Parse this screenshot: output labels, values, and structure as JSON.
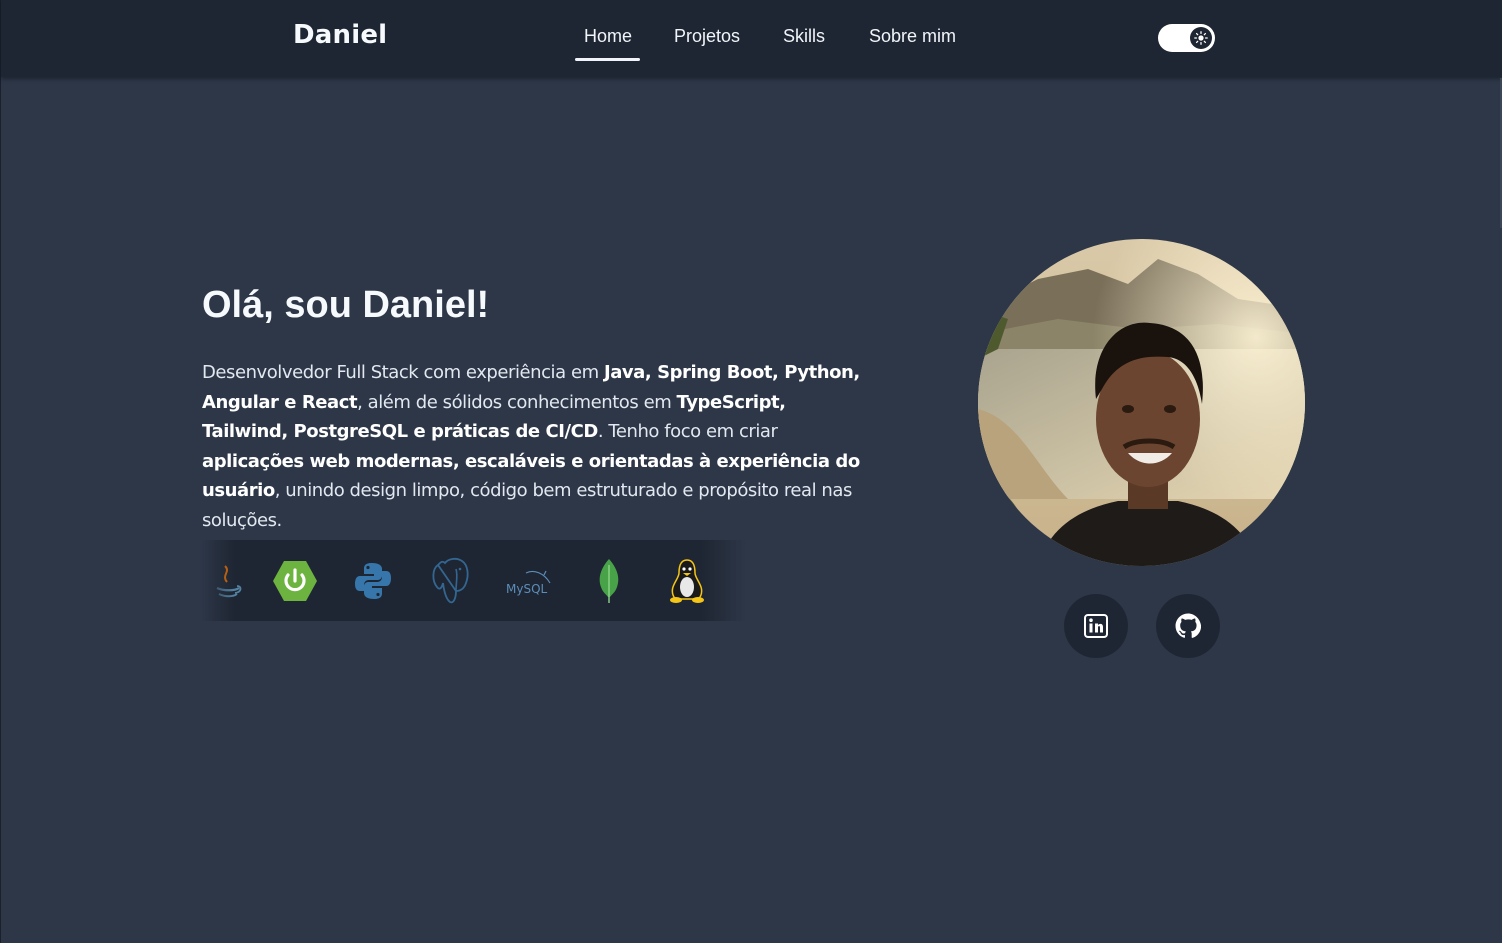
{
  "navbar": {
    "brand": "Daniel",
    "links": [
      {
        "label": "Home",
        "active": true
      },
      {
        "label": "Projetos",
        "active": false
      },
      {
        "label": "Skills",
        "active": false
      },
      {
        "label": "Sobre mim",
        "active": false
      }
    ],
    "theme_toggle": {
      "icon": "sun-icon",
      "on": true
    }
  },
  "hero": {
    "title": "Olá, sou Daniel!",
    "intro": {
      "t1": "Desenvolvedor Full Stack com experiência em ",
      "b1": "Java, Spring Boot, Python, Angular e React",
      "t2": ", além de sólidos conhecimentos em ",
      "b2": "TypeScript, Tailwind, PostgreSQL e práticas de CI/CD",
      "t3": ". Tenho foco em criar ",
      "b3": "aplicações web modernas, escaláveis e orientadas à experiência do usuário",
      "t4": ", unindo design limpo, código bem estruturado e propósito real nas soluções."
    },
    "skills": [
      {
        "name": "java-icon"
      },
      {
        "name": "spring-boot-icon"
      },
      {
        "name": "python-icon"
      },
      {
        "name": "postgresql-icon"
      },
      {
        "name": "mysql-icon",
        "label": "MySQL"
      },
      {
        "name": "mongodb-icon"
      },
      {
        "name": "linux-icon"
      }
    ]
  },
  "profile": {
    "photo": "profile-photo",
    "social": [
      {
        "name": "linkedin-icon"
      },
      {
        "name": "github-icon"
      }
    ]
  },
  "colors": {
    "background": "#2d3748",
    "navbar": "#1f2633",
    "text": "#e2e8f0",
    "spring": "#6db33f",
    "python_blue": "#3776ab",
    "python_yellow": "#ffd43b",
    "postgres": "#336791",
    "mongodb": "#47a248",
    "linux_yellow": "#f5c518"
  }
}
